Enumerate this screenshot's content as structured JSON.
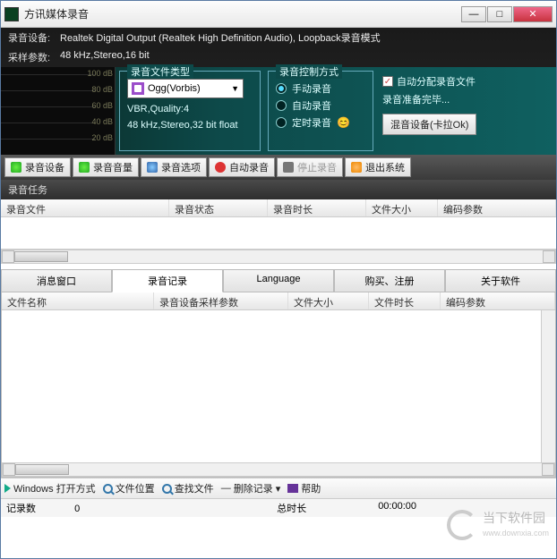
{
  "title": "方讯媒体录音",
  "info": {
    "device_label": "录音设备:",
    "device_value": "Realtek Digital Output (Realtek High Definition Audio), Loopback录音模式",
    "sample_label": "采样参数:",
    "sample_value": "48   kHz,Stereo,16 bit"
  },
  "meter_labels": [
    "100 dB",
    "80 dB",
    "60 dB",
    "40 dB",
    "20 dB"
  ],
  "filetype": {
    "legend": "录音文件类型",
    "selected": "Ogg(Vorbis)",
    "quality": "VBR,Quality:4",
    "format": "48   kHz,Stereo,32 bit float"
  },
  "control": {
    "legend": "录音控制方式",
    "opts": [
      "手动录音",
      "自动录音",
      "定时录音"
    ]
  },
  "right": {
    "auto_alloc": "自动分配录音文件",
    "ready": "录音准备完毕...",
    "mix_btn": "混音设备(卡拉Ok)"
  },
  "toolbar": [
    "录音设备",
    "录音音量",
    "录音选项",
    "自动录音",
    "停止录音",
    "退出系统"
  ],
  "tasks_title": "录音任务",
  "task_cols": [
    "录音文件",
    "录音状态",
    "录音时长",
    "文件大小",
    "编码参数"
  ],
  "tabs": [
    "消息窗口",
    "录音记录",
    "Language",
    "购买、注册",
    "关于软件"
  ],
  "list_cols": [
    "文件名称",
    "录音设备采样参数",
    "文件大小",
    "文件时长",
    "编码参数"
  ],
  "bottom": {
    "open": "Windows 打开方式",
    "loc": "文件位置",
    "find": "查找文件",
    "del": "删除记录",
    "help": "帮助"
  },
  "status": {
    "count_label": "记录数",
    "count": "0",
    "dur_label": "总时长",
    "dur": "00:00:00"
  },
  "watermark": {
    "name": "当下软件园",
    "url": "www.downxia.com"
  }
}
